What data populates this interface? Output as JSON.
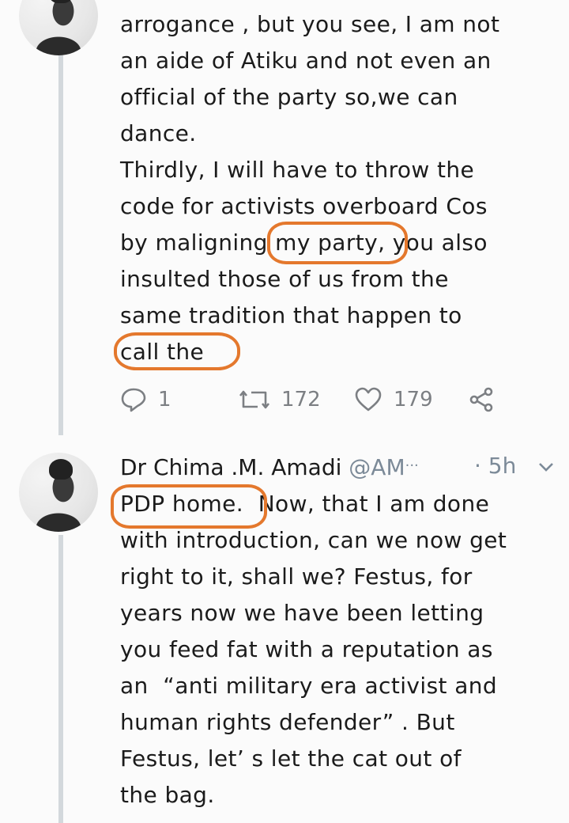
{
  "tweet1": {
    "lines": [
      "arrogance , but you see, I am not",
      "an aide of Atiku and not even an",
      "official of the party so,we can",
      "dance.",
      "Thirdly, I will have to throw the",
      "code for activists overboard Cos",
      "by maligning my party, you also",
      "insulted those of us from the",
      "same tradition that happen to",
      "call the"
    ],
    "actions": {
      "reply_count": "1",
      "retweet_count": "172",
      "like_count": "179"
    }
  },
  "tweet2": {
    "author_name": "Dr Chima .M. Amadi",
    "handle": "@AM",
    "handle_ellipsis": "···",
    "time": "· 5h",
    "lines": [
      "PDP home.  Now, that I am done",
      "with introduction, can we now get",
      "right to it, shall we? Festus, for",
      "years now we have been letting",
      "you feed fat with a reputation as",
      "an  “anti military era activist and",
      "human rights defender” . But",
      "Festus, let’ s let the cat out of",
      "the bag."
    ]
  },
  "colors": {
    "annotation": "#e4782d",
    "icon_gray": "#7c7f83",
    "handle_gray": "#7c8a98",
    "thread_line": "#d3d8dc"
  },
  "icons": [
    "reply-icon",
    "retweet-icon",
    "like-icon",
    "share-icon",
    "chevron-down-icon"
  ]
}
